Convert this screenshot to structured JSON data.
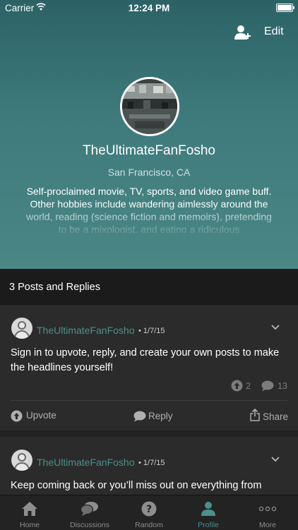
{
  "status_bar": {
    "carrier": "Carrier",
    "time": "12:24 PM"
  },
  "header": {
    "edit_label": "Edit",
    "username": "TheUltimateFanFosho",
    "location": "San Francisco, CA",
    "bio": "Self-proclaimed movie, TV, sports, and video game buff. Other hobbies include wandering aimlessly around the world, reading (science fiction and memoirs), pretending to be a mixologist, and eating a ridiculous"
  },
  "posts_count_label": "3 Posts and Replies",
  "posts": [
    {
      "username": "TheUltimateFanFosho",
      "date": "• 1/7/15",
      "text": "Sign in to upvote, reply, and create your own posts to make the headlines yourself!",
      "upvotes": "2",
      "replies": "13",
      "actions": {
        "upvote": "Upvote",
        "reply": "Reply",
        "share": "Share"
      }
    },
    {
      "username": "TheUltimateFanFosho",
      "date": "• 1/7/15",
      "text": "Keep coming back or you’ll miss out on everything from"
    }
  ],
  "tabs": [
    {
      "label": "Home",
      "icon": "home-icon"
    },
    {
      "label": "Discussions",
      "icon": "discussions-icon"
    },
    {
      "label": "Random",
      "icon": "random-icon"
    },
    {
      "label": "Profile",
      "icon": "profile-icon"
    },
    {
      "label": "More",
      "icon": "more-icon"
    }
  ],
  "colors": {
    "accent": "#4c8f8b",
    "header_top": "#2c6266",
    "header_bottom": "#4a8684",
    "card": "#2b2b2b"
  }
}
